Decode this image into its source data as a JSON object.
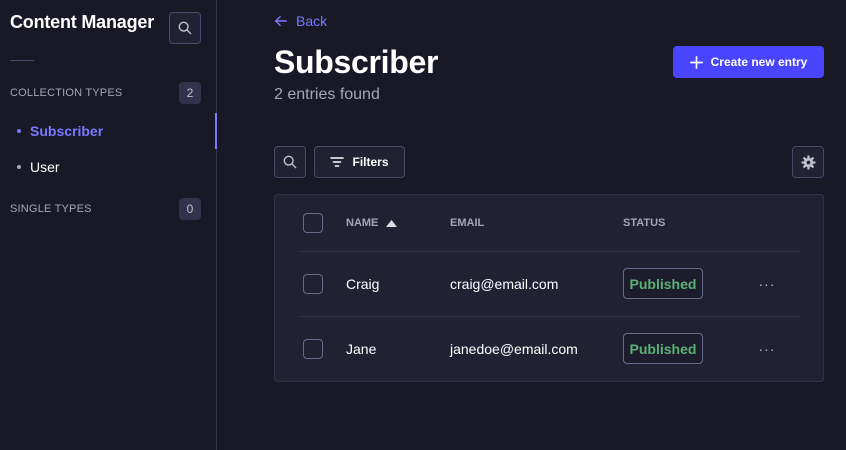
{
  "sidebar": {
    "title": "Content Manager",
    "collection_types": {
      "label": "COLLECTION TYPES",
      "count": "2"
    },
    "items": [
      {
        "label": "Subscriber",
        "active": true
      },
      {
        "label": "User",
        "active": false
      }
    ],
    "single_types": {
      "label": "SINGLE TYPES",
      "count": "0"
    }
  },
  "header": {
    "back_label": "Back",
    "title": "Subscriber",
    "subtitle": "2 entries found",
    "create_label": "Create new entry"
  },
  "toolbar": {
    "filters_label": "Filters"
  },
  "table": {
    "columns": [
      "NAME",
      "EMAIL",
      "STATUS"
    ],
    "sort": {
      "column": "NAME",
      "direction": "asc"
    },
    "rows": [
      {
        "name": "Craig",
        "email": "craig@email.com",
        "status": "Published"
      },
      {
        "name": "Jane",
        "email": "janedoe@email.com",
        "status": "Published"
      }
    ],
    "more_label": "···"
  },
  "colors": {
    "accent": "#7b79ff",
    "primary_button": "#4945ff",
    "published": "#5cb176",
    "background": "#181826",
    "panel": "#212134"
  },
  "icons": [
    "search-icon",
    "arrow-left-icon",
    "plus-icon",
    "filter-icon",
    "gear-icon",
    "sort-up-icon",
    "more-icon"
  ]
}
